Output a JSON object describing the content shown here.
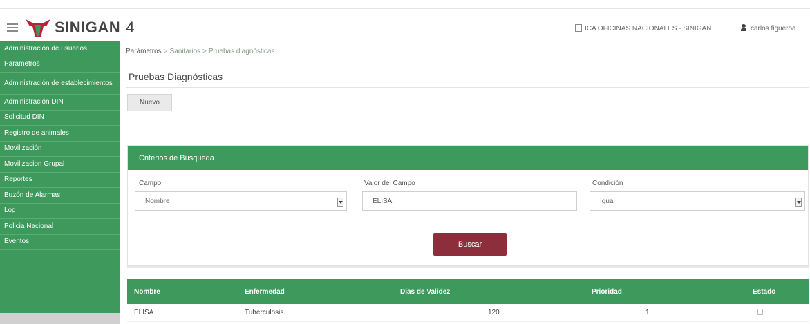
{
  "header": {
    "brand": "SINIGAN",
    "version": "4",
    "office": "ICA OFICINAS NACIONALES - SINIGAN",
    "user": "carlos figueroa"
  },
  "sidebar": {
    "items": [
      {
        "label": "Administración de usuarios"
      },
      {
        "label": "Parametros"
      },
      {
        "label": "Administración de establecimientos"
      },
      {
        "label": "Administración DIN"
      },
      {
        "label": "Solicitud DIN"
      },
      {
        "label": "Registro de animales"
      },
      {
        "label": "Movilización"
      },
      {
        "label": "Movilizacion Grupal"
      },
      {
        "label": "Reportes"
      },
      {
        "label": "Buzón de Alarmas"
      },
      {
        "label": "Log"
      },
      {
        "label": "Policia Nacional"
      },
      {
        "label": "Eventos"
      }
    ]
  },
  "breadcrumb": {
    "root": "Parámetros",
    "sep": ">",
    "middle": "Sanitarios",
    "current": "Pruebas diagnósticas"
  },
  "page": {
    "title": "Pruebas Diagnósticas",
    "new_button": "Nuevo"
  },
  "search": {
    "panel_title": "Criterios de Búsqueda",
    "field_label": "Campo",
    "field_value": "Nombre",
    "value_label": "Valor del Campo",
    "value_input": "ELISA",
    "condition_label": "Condición",
    "condition_value": "Igual",
    "search_button": "Buscar"
  },
  "table": {
    "headers": [
      "Nombre",
      "Enfermedad",
      "Dias de Validez",
      "Prioridad",
      "Estado"
    ],
    "rows": [
      {
        "nombre": "ELISA",
        "enfermedad": "Tuberculosis",
        "validez": "120",
        "prioridad": "1",
        "estado": false
      }
    ]
  },
  "colors": {
    "accent_green": "#3d9a5c",
    "button_maroon": "#8c2e3b"
  }
}
